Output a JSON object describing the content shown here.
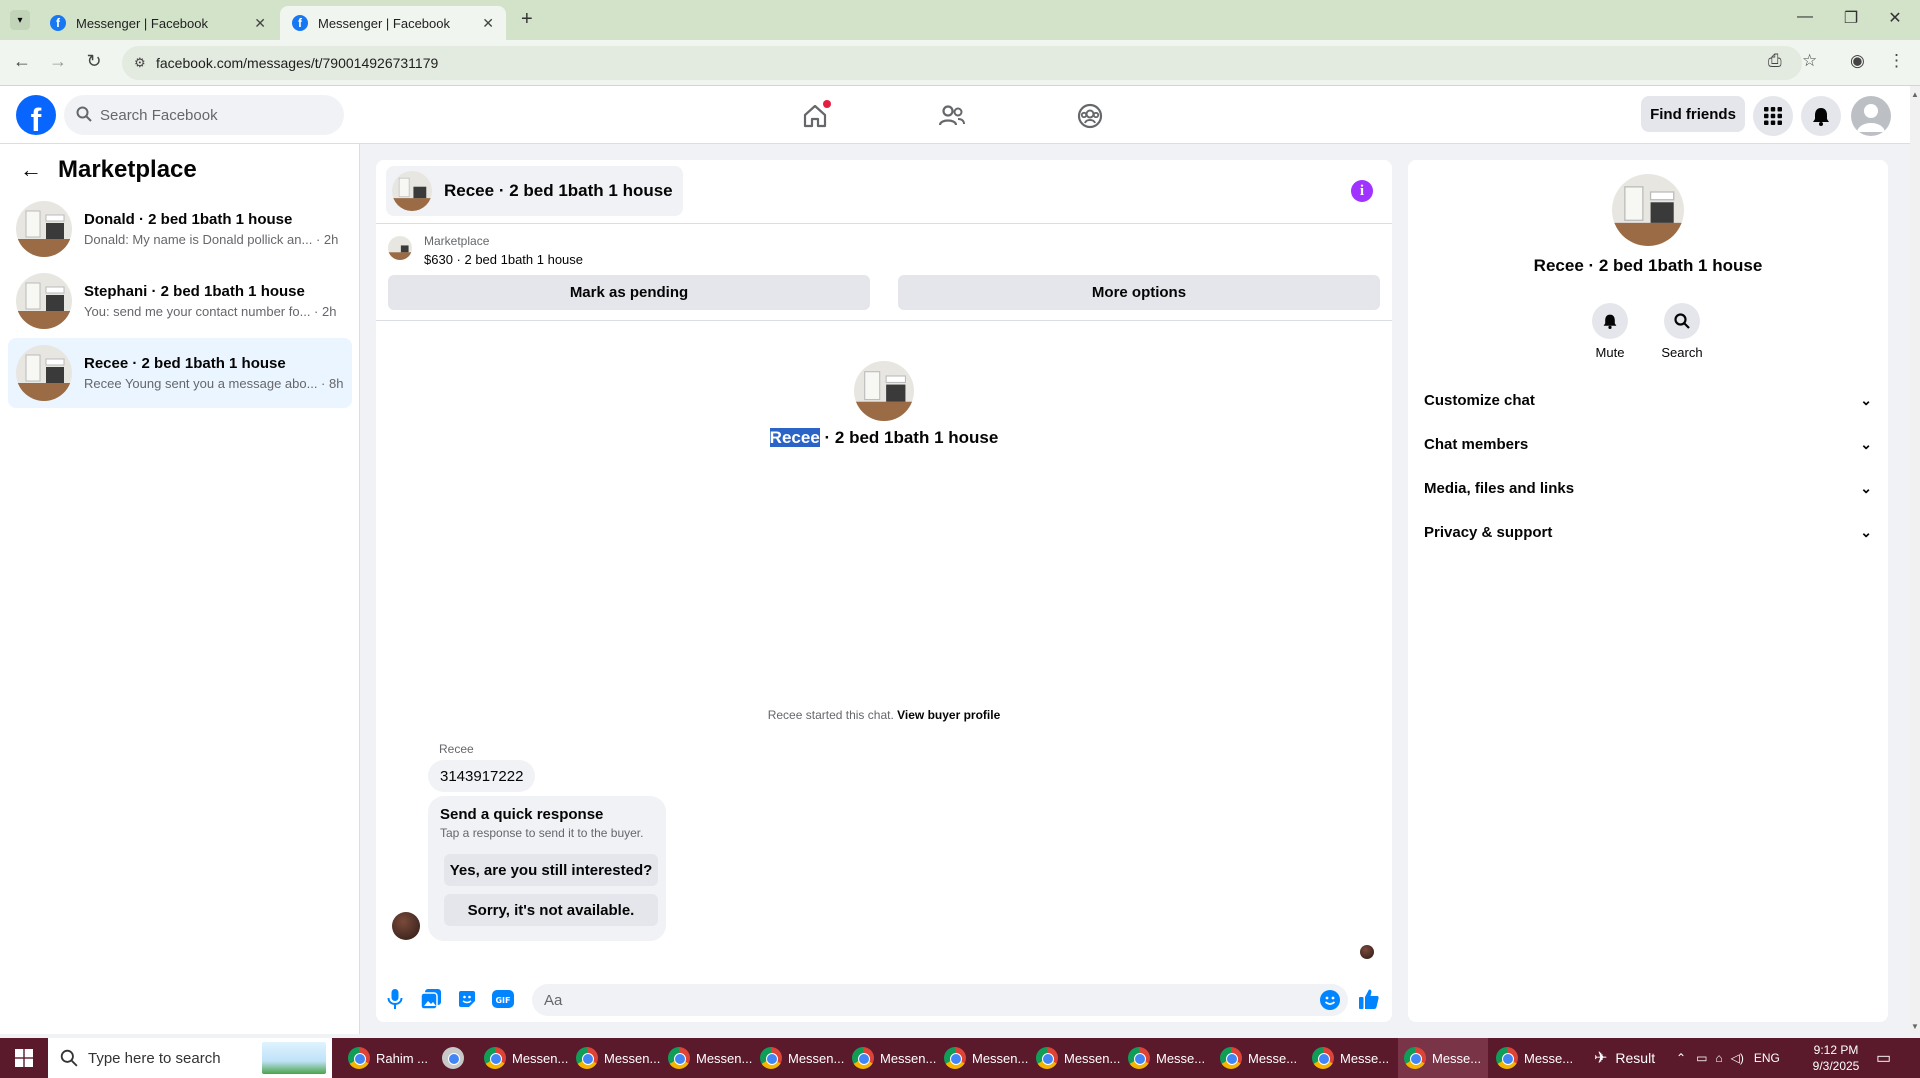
{
  "browser": {
    "tabs": [
      {
        "title": "Messenger | Facebook",
        "active": false
      },
      {
        "title": "Messenger | Facebook",
        "active": true
      }
    ],
    "url": "facebook.com/messages/t/790014926731179"
  },
  "fb_nav": {
    "search_placeholder": "Search Facebook",
    "find_friends": "Find friends",
    "colors": {
      "brand": "#0866ff",
      "notification": "#e41e3f"
    }
  },
  "sidebar": {
    "title": "Marketplace",
    "conversations": [
      {
        "name": "Donald · 2 bed 1bath 1 house",
        "snippet": "Donald: My name is Donald pollick an... · 2h",
        "active": false
      },
      {
        "name": "Stephani · 2 bed 1bath 1 house",
        "snippet": "You: send me your contact number fo... · 2h",
        "active": false
      },
      {
        "name": "Recee · 2 bed 1bath 1 house",
        "snippet": "Recee Young sent you a message abo... · 8h",
        "active": true
      }
    ]
  },
  "chat": {
    "header_title": "Recee · 2 bed 1bath 1 house",
    "listing_label": "Marketplace",
    "listing_price": "$630 · 2 bed 1bath 1 house",
    "mark_pending": "Mark as pending",
    "more_options": "More options",
    "center_name_highlight": "Recee",
    "center_name_rest": " · 2 bed 1bath 1 house",
    "started_text": "Recee started this chat. ",
    "view_buyer_profile": "View buyer profile",
    "sender": "Recee",
    "message": "3143917222",
    "quick_title": "Send a quick response",
    "quick_sub": "Tap a response to send it to the buyer.",
    "quick_replies": [
      "Yes, are you still interested?",
      "Sorry, it's not available."
    ],
    "input_placeholder": "Aa",
    "composer_icons": [
      "microphone-icon",
      "photo-icon",
      "sticker-icon",
      "gif-icon",
      "emoji-icon",
      "thumbs-up-icon"
    ],
    "gif_label": "GIF",
    "accent": "#0084ff"
  },
  "info_panel": {
    "title": "Recee · 2 bed 1bath 1 house",
    "actions": [
      {
        "label": "Mute",
        "icon": "bell-icon"
      },
      {
        "label": "Search",
        "icon": "search-icon"
      }
    ],
    "sections": [
      "Customize chat",
      "Chat members",
      "Media, files and links",
      "Privacy & support"
    ]
  },
  "taskbar": {
    "search_placeholder": "Type here to search",
    "apps": [
      "Rahim ...",
      "",
      "Messen...",
      "Messen...",
      "Messen...",
      "Messen...",
      "Messen...",
      "Messen...",
      "Messen...",
      "Messe...",
      "Messe...",
      "Messe...",
      "Messe...",
      "Messe..."
    ],
    "weather": "Result",
    "language": "ENG",
    "time": "9:12 PM",
    "date": "9/3/2025"
  }
}
